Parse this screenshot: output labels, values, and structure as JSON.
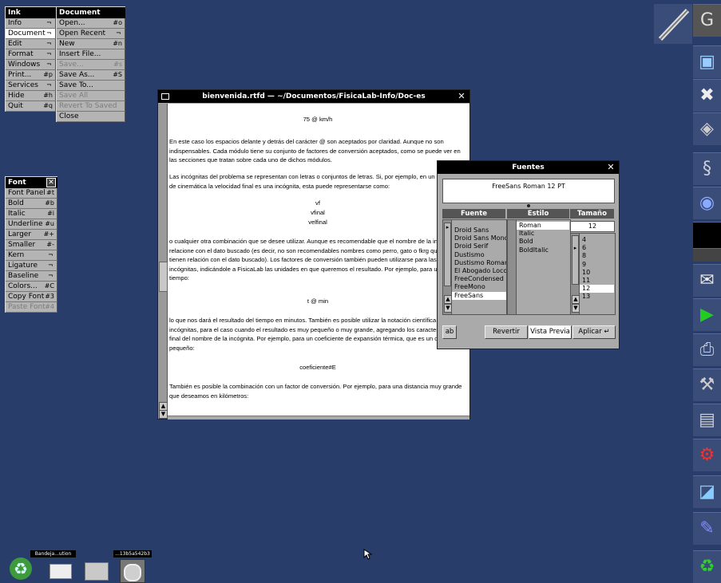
{
  "ink_menu": {
    "title": "Ink",
    "items": [
      {
        "label": "Info",
        "key": "",
        "submenu": true,
        "selected": false,
        "disabled": false
      },
      {
        "label": "Document",
        "key": "",
        "submenu": true,
        "selected": true,
        "disabled": false
      },
      {
        "label": "Edit",
        "key": "",
        "submenu": true,
        "selected": false,
        "disabled": false
      },
      {
        "label": "Format",
        "key": "",
        "submenu": true,
        "selected": false,
        "disabled": false
      },
      {
        "label": "Windows",
        "key": "",
        "submenu": true,
        "selected": false,
        "disabled": false
      },
      {
        "label": "Print...",
        "key": "#p",
        "submenu": false,
        "selected": false,
        "disabled": false
      },
      {
        "label": "Services",
        "key": "",
        "submenu": true,
        "selected": false,
        "disabled": false
      },
      {
        "label": "Hide",
        "key": "#h",
        "submenu": false,
        "selected": false,
        "disabled": false
      },
      {
        "label": "Quit",
        "key": "#q",
        "submenu": false,
        "selected": false,
        "disabled": false
      }
    ]
  },
  "document_menu": {
    "title": "Document",
    "items": [
      {
        "label": "Open...",
        "key": "#o",
        "submenu": false,
        "disabled": false
      },
      {
        "label": "Open Recent",
        "key": "",
        "submenu": true,
        "disabled": false
      },
      {
        "label": "New",
        "key": "#n",
        "submenu": false,
        "disabled": false
      },
      {
        "label": "Insert File...",
        "key": "",
        "submenu": false,
        "disabled": false
      },
      {
        "label": "Save...",
        "key": "#s",
        "submenu": false,
        "disabled": true
      },
      {
        "label": "Save As...",
        "key": "#S",
        "submenu": false,
        "disabled": false
      },
      {
        "label": "Save To...",
        "key": "",
        "submenu": false,
        "disabled": false
      },
      {
        "label": "Save All",
        "key": "",
        "submenu": false,
        "disabled": true
      },
      {
        "label": "Revert To Saved",
        "key": "",
        "submenu": false,
        "disabled": true
      },
      {
        "label": "Close",
        "key": "",
        "submenu": false,
        "disabled": false
      }
    ]
  },
  "font_menu": {
    "title": "Font",
    "items": [
      {
        "label": "Font Panel",
        "key": "#t",
        "submenu": false,
        "disabled": false
      },
      {
        "label": "Bold",
        "key": "#b",
        "submenu": false,
        "disabled": false
      },
      {
        "label": "Italic",
        "key": "#i",
        "submenu": false,
        "disabled": false
      },
      {
        "label": "Underline",
        "key": "#u",
        "submenu": false,
        "disabled": false
      },
      {
        "label": "Larger",
        "key": "#+",
        "submenu": false,
        "disabled": false
      },
      {
        "label": "Smaller",
        "key": "#-",
        "submenu": false,
        "disabled": false
      },
      {
        "label": "Kern",
        "key": "",
        "submenu": true,
        "disabled": false
      },
      {
        "label": "Ligature",
        "key": "",
        "submenu": true,
        "disabled": false
      },
      {
        "label": "Baseline",
        "key": "",
        "submenu": true,
        "disabled": false
      },
      {
        "label": "Colors...",
        "key": "#C",
        "submenu": false,
        "disabled": false
      },
      {
        "label": "Copy Font",
        "key": "#3",
        "submenu": false,
        "disabled": false
      },
      {
        "label": "Paste Font",
        "key": "#4",
        "submenu": false,
        "disabled": true
      }
    ]
  },
  "document_window": {
    "title": "bienvenida.rtfd — ~/Documentos/FisicaLab-Info/Doc-es",
    "paragraphs": [
      {
        "text": "75 @ km/h",
        "center": true
      },
      {
        "text": "En este caso los espacios delante y detrás del carácter @ son aceptados por claridad. Aunque no son indispensables. Cada módulo tiene su conjunto de factores de conversión aceptados, como se puede ver en las secciones que tratan sobre cada uno de dichos módulos.",
        "center": false
      },
      {
        "text": "Las incógnitas del problema se representan con letras o conjuntos de letras. Si, por ejemplo, en un problema de cinemática la velocidad final es una incógnita, esta puede representarse como:",
        "center": false
      },
      {
        "text": "vf",
        "center": true
      },
      {
        "text": "vfinal",
        "center": true
      },
      {
        "text": "velfinal",
        "center": true
      },
      {
        "text": "o cualquier otra combinación que se desee utilizar. Aunque es recomendable que el nombre de la incógnita se relacione con el dato buscado (es decir, no son recomendables nombres como perro, gato o fkrg que no tienen relación con el dato buscado). Los factores de conversión también pueden utilizarse para las incógnitas, indicándole a FisicaLab las unidades en que queremos el resultado. Por ejemplo, para un dato de tiempo:",
        "center": false
      },
      {
        "text": "t @ min",
        "center": true
      },
      {
        "text": "lo que nos dará el resultado del tiempo en minutos. También es posible utilizar la notación científica en las incógnitas, para el caso cuando el resultado es muy pequeño o muy grande, agregando los caracteres #E al final del nombre de la incógnita. Por ejemplo, para un coeficiente de expansión térmica, que es un dato muy pequeño:",
        "center": false
      },
      {
        "text": "coeficiente#E",
        "center": true
      },
      {
        "text": "También es posible la combinación con un factor de conversión. Por ejemplo, para una distancia muy grande que deseamos en kilómetros:",
        "center": false
      }
    ]
  },
  "font_panel": {
    "title": "Fuentes",
    "preview": "FreeSans Roman 12 PT",
    "col_family": "Fuente",
    "col_style": "Estilo",
    "col_size": "Tamaño",
    "families": [
      "Droid Sans",
      "Droid Sans Mono",
      "Droid Serif",
      "Dustismo",
      "Dustismo Roman",
      "El Abogado Loco",
      "FreeCondensed",
      "FreeMono",
      "FreeSans"
    ],
    "selected_family": "FreeSans",
    "styles": [
      "Roman",
      "Italic",
      "Bold",
      "BoldItalic"
    ],
    "selected_style": "Roman",
    "size_value": "12",
    "sizes": [
      "4",
      "6",
      "8",
      "9",
      "10",
      "11",
      "12",
      "13"
    ],
    "selected_size": "12",
    "revert_label": "Revertir",
    "preview_label": "Vista Previa",
    "apply_label": "Aplicar"
  },
  "shelf": {
    "items": [
      {
        "label": "",
        "icon": "recycler-icon"
      },
      {
        "label": "Bandeja...ution",
        "icon": "mail-icon"
      },
      {
        "label": "",
        "icon": "folder-icon"
      },
      {
        "label": "...13b5a542b3",
        "icon": "disk-icon"
      }
    ]
  },
  "colors": {
    "desktop": "#283d69",
    "menu_title": "#000000",
    "menu_bg": "#b4b4b4"
  }
}
